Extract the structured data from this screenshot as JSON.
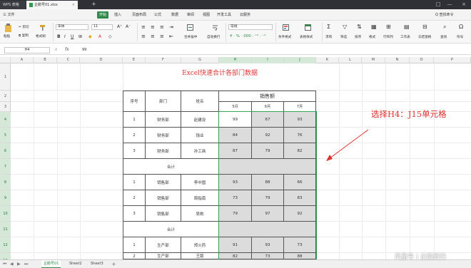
{
  "titlebar": {
    "app_tab": "WPS 表格",
    "file_tab": "企鹅号01.xlsx",
    "new_tab": "+",
    "controls": [
      "□",
      "—",
      "×"
    ]
  },
  "menubar": {
    "items": [
      "三 文件",
      "开始",
      "插入",
      "页面布局",
      "公式",
      "数据",
      "审阅",
      "视图",
      "开发工具",
      "云服务"
    ],
    "active": "开始",
    "search": "Q 查找命令"
  },
  "ribbon": {
    "paste": "粘贴",
    "cut": "剪切",
    "copy": "复制",
    "format_painter": "格式刷",
    "font_name": "宋体",
    "font_size": "11",
    "merge_center": "合并居中",
    "auto_wrap": "自动换行",
    "number_format": "常规",
    "conditional_format": "条件格式",
    "table_style": "表格样式",
    "sum": "求和",
    "filter": "筛选",
    "sort": "排序",
    "fmt": "格式",
    "rows_cols": "行和列",
    "worksheet": "工作表",
    "freeze": "冻结窗格",
    "find": "查找",
    "symbol": "符号"
  },
  "formula_bar": {
    "name_box": "H4",
    "fx": "fx",
    "content": "99"
  },
  "columns": [
    "A",
    "B",
    "C",
    "D",
    "E",
    "F",
    "G",
    "H",
    "I",
    "J",
    "K",
    "L",
    "M",
    "N",
    "O",
    "P"
  ],
  "rows": [
    "1",
    "2",
    "3",
    "4",
    "5",
    "6",
    "7",
    "8",
    "9",
    "10",
    "11",
    "12",
    "13"
  ],
  "table": {
    "title": "Excel快速合计各部门数据",
    "headers": {
      "no": "序号",
      "dept": "部门",
      "name": "姓名",
      "sales": "销售额",
      "months": [
        "5月",
        "6月",
        "7月"
      ]
    },
    "subtotal_label": "合计",
    "rows": [
      {
        "no": "1",
        "dept": "财务部",
        "name": "赵建设",
        "m5": "99",
        "m6": "67",
        "m7": "93"
      },
      {
        "no": "2",
        "dept": "财务部",
        "name": "钱业",
        "m5": "84",
        "m6": "92",
        "m7": "76"
      },
      {
        "no": "3",
        "dept": "财务部",
        "name": "孙工商",
        "m5": "87",
        "m6": "79",
        "m7": "82"
      },
      {
        "no": "1",
        "dept": "销售部",
        "name": "李中国",
        "m5": "93",
        "m6": "88",
        "m7": "66"
      },
      {
        "no": "2",
        "dept": "销售部",
        "name": "周指南",
        "m5": "73",
        "m6": "79",
        "m7": "83"
      },
      {
        "no": "3",
        "dept": "销售部",
        "name": "吴刷",
        "m5": "79",
        "m6": "97",
        "m7": "92"
      },
      {
        "no": "1",
        "dept": "生产部",
        "name": "郑火药",
        "m5": "91",
        "m6": "93",
        "m7": "73"
      },
      {
        "no": "2",
        "dept": "生产部",
        "name": "王版",
        "m5": "82",
        "m6": "73",
        "m7": "88"
      }
    ]
  },
  "annotation": "选择H4：J15单元格",
  "sheets": [
    "企鹅号01",
    "Sheet2",
    "Sheet3"
  ],
  "active_sheet": "企鹅号01",
  "watermark": "风凰号 | 企鹅商归",
  "colors": {
    "accent": "#2e8b4a",
    "annotation": "#e03030",
    "selection": "#3aa05a"
  }
}
